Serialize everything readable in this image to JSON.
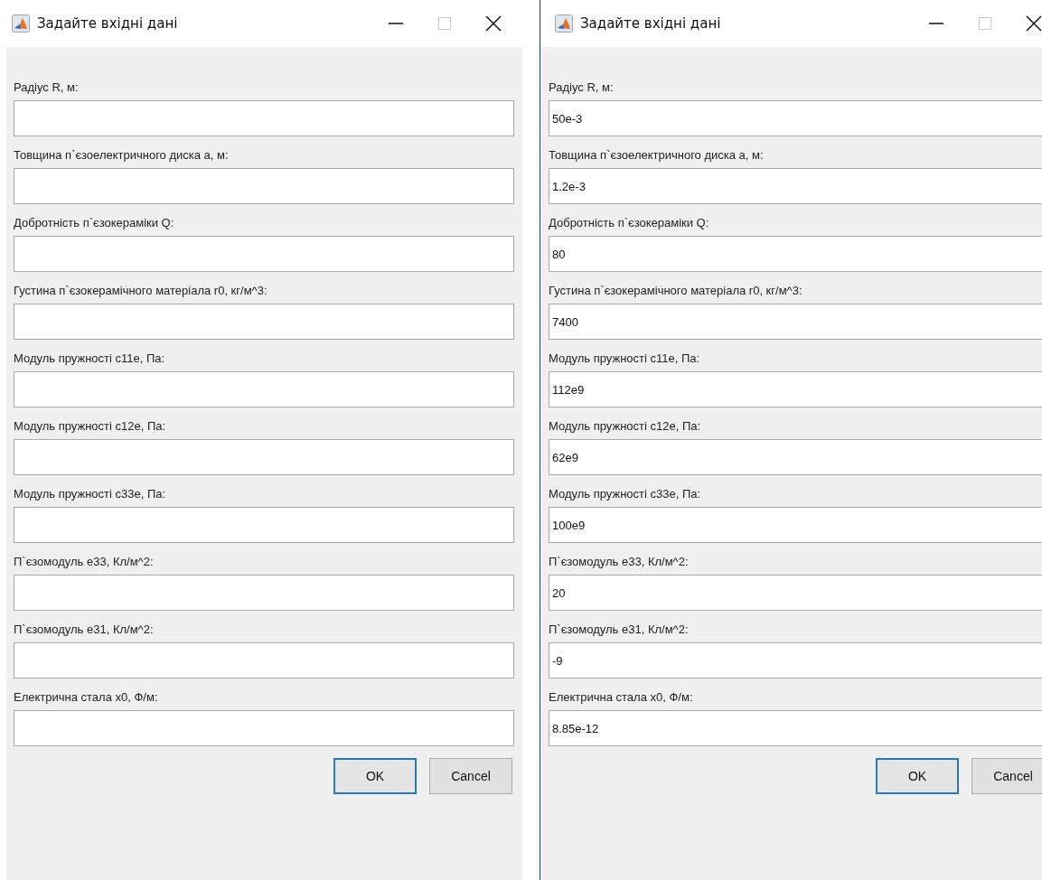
{
  "windows": [
    {
      "title": "Задайте вхідні дані",
      "fields": [
        {
          "label": "Радіус R, м:"
        },
        {
          "label": "Товщина п`єзоелектричного диска a, м:"
        },
        {
          "label": "Добротність п`єзокераміки Q:"
        },
        {
          "label": "Густина п`єзокерамічного матеріала r0, кг/м^3:"
        },
        {
          "label": "Модуль пружності c11e, Па:"
        },
        {
          "label": "Модуль пружності c12e, Па:"
        },
        {
          "label": "Модуль пружності c33e, Па:"
        },
        {
          "label": "П`єзомодуль e33, Кл/м^2:"
        },
        {
          "label": "П`єзомодуль e31, Кл/м^2:"
        },
        {
          "label": "Електрична стала x0, Ф/м:"
        }
      ],
      "buttons": [
        {
          "label": "OK",
          "default": true
        },
        {
          "label": "Cancel",
          "default": false
        }
      ]
    },
    {
      "title": "Задайте вхідні дані",
      "fields": [
        {
          "label": "Радіус R, м:",
          "value": "50e-3"
        },
        {
          "label": "Товщина п`єзоелектричного диска a, м:",
          "value": "1.2e-3"
        },
        {
          "label": "Добротність п`єзокераміки Q:",
          "value": "80"
        },
        {
          "label": "Густина п`єзокерамічного матеріала r0, кг/м^3:",
          "value": "7400"
        },
        {
          "label": "Модуль пружності c11e, Па:",
          "value": "112e9"
        },
        {
          "label": "Модуль пружності c12e, Па:",
          "value": "62e9"
        },
        {
          "label": "Модуль пружності c33e, Па:",
          "value": "100e9"
        },
        {
          "label": "П`єзомодуль e33, Кл/м^2:",
          "value": "20"
        },
        {
          "label": "П`єзомодуль e31, Кл/м^2:",
          "value": "-9"
        },
        {
          "label": "Електрична стала x0, Ф/м:",
          "value": "8.85e-12"
        }
      ],
      "buttons": [
        {
          "label": "OK",
          "default": true
        },
        {
          "label": "Cancel",
          "default": false
        }
      ]
    }
  ]
}
